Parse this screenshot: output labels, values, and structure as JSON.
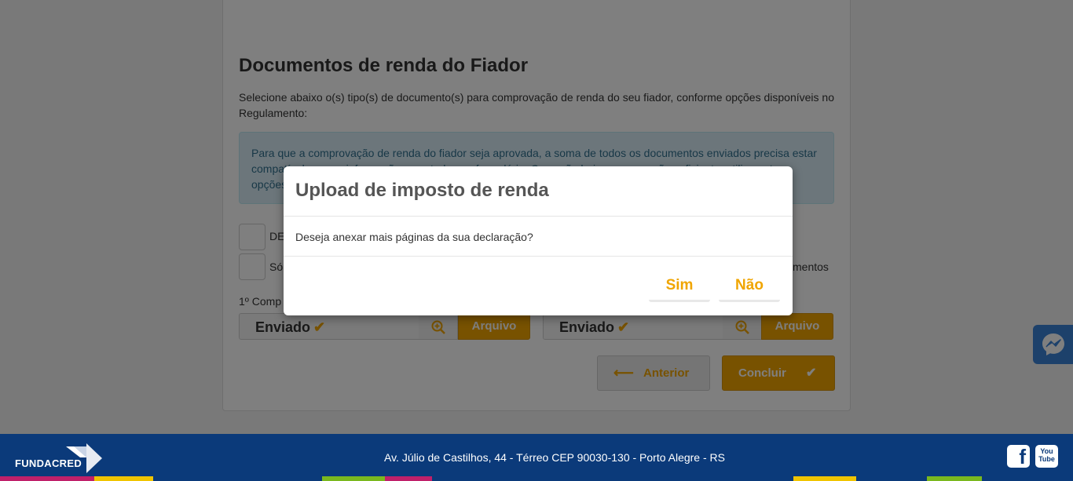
{
  "section": {
    "title": "Documentos de renda do Fiador",
    "lead": "Selecione abaixo o(s) tipo(s) de documento(s) para comprovação de renda do seu fiador, conforme opções disponíveis no Regulamento:",
    "alert": "Para que a comprovação de renda do fiador seja aprovada, a soma de todos os documentos enviados precisa estar compatível com as informações prestadas no formulário. Caso não haja comprovação suficiente, utilize outras opções de renda."
  },
  "checkboxes": [
    {
      "label": "DE"
    },
    {
      "label": "Só",
      "trailing": "mentos"
    }
  ],
  "upload_label": "1º Comp",
  "uploads": [
    {
      "status": "Enviado",
      "button": "Arquivo"
    },
    {
      "status": "Enviado",
      "button": "Arquivo"
    }
  ],
  "nav": {
    "prev_label": "Anterior",
    "next_label": "Concluir"
  },
  "modal": {
    "title": "Upload de imposto de renda",
    "body": "Deseja anexar mais páginas da sua declaração?",
    "yes": "Sim",
    "no": "Não"
  },
  "footer": {
    "brand": "FUNDACRED",
    "address": "Av. Júlio de Castilhos, 44 - Térreo CEP 90030-130 - Porto Alegre - RS",
    "youtube_text": "You Tube"
  },
  "colors": {
    "accent": "#f0a500",
    "footer_bg": "#0b3a7a",
    "messenger_bg": "#3b82d6"
  }
}
